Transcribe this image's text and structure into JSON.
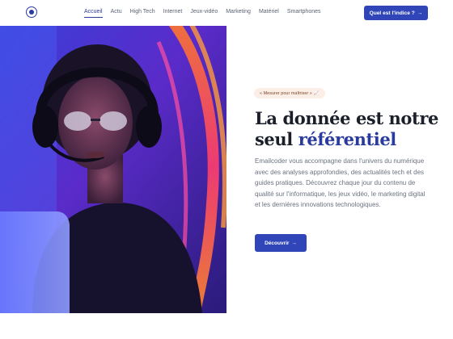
{
  "header": {
    "nav": [
      {
        "label": "Accueil",
        "active": true
      },
      {
        "label": "Actu"
      },
      {
        "label": "High Tech"
      },
      {
        "label": "Internet"
      },
      {
        "label": "Jeux-vidéo"
      },
      {
        "label": "Marketing"
      },
      {
        "label": "Matériel"
      },
      {
        "label": "Smartphones"
      }
    ],
    "cta_label": "Quel est l'indice ?",
    "cta_arrow": "→"
  },
  "hero": {
    "badge_text": "« Mesurer pour maîtriser »",
    "badge_emoji": "📈",
    "title_line1": "La donnée est notre",
    "title_line2_plain": "seul ",
    "title_line2_accent": "référentiel",
    "description": "Emailcoder vous accompagne dans l'univers du numérique avec des analyses approfondies, des actualités tech et des guides pratiques. Découvrez chaque jour du contenu de qualité sur l'informatique, les jeux vidéo, le marketing digital et les dernières innovations technologiques.",
    "button_label": "Découvrir",
    "button_arrow": "→"
  },
  "colors": {
    "accent": "#2a3b9e",
    "button": "#2f45b8",
    "badge_bg": "#fbeee6"
  }
}
